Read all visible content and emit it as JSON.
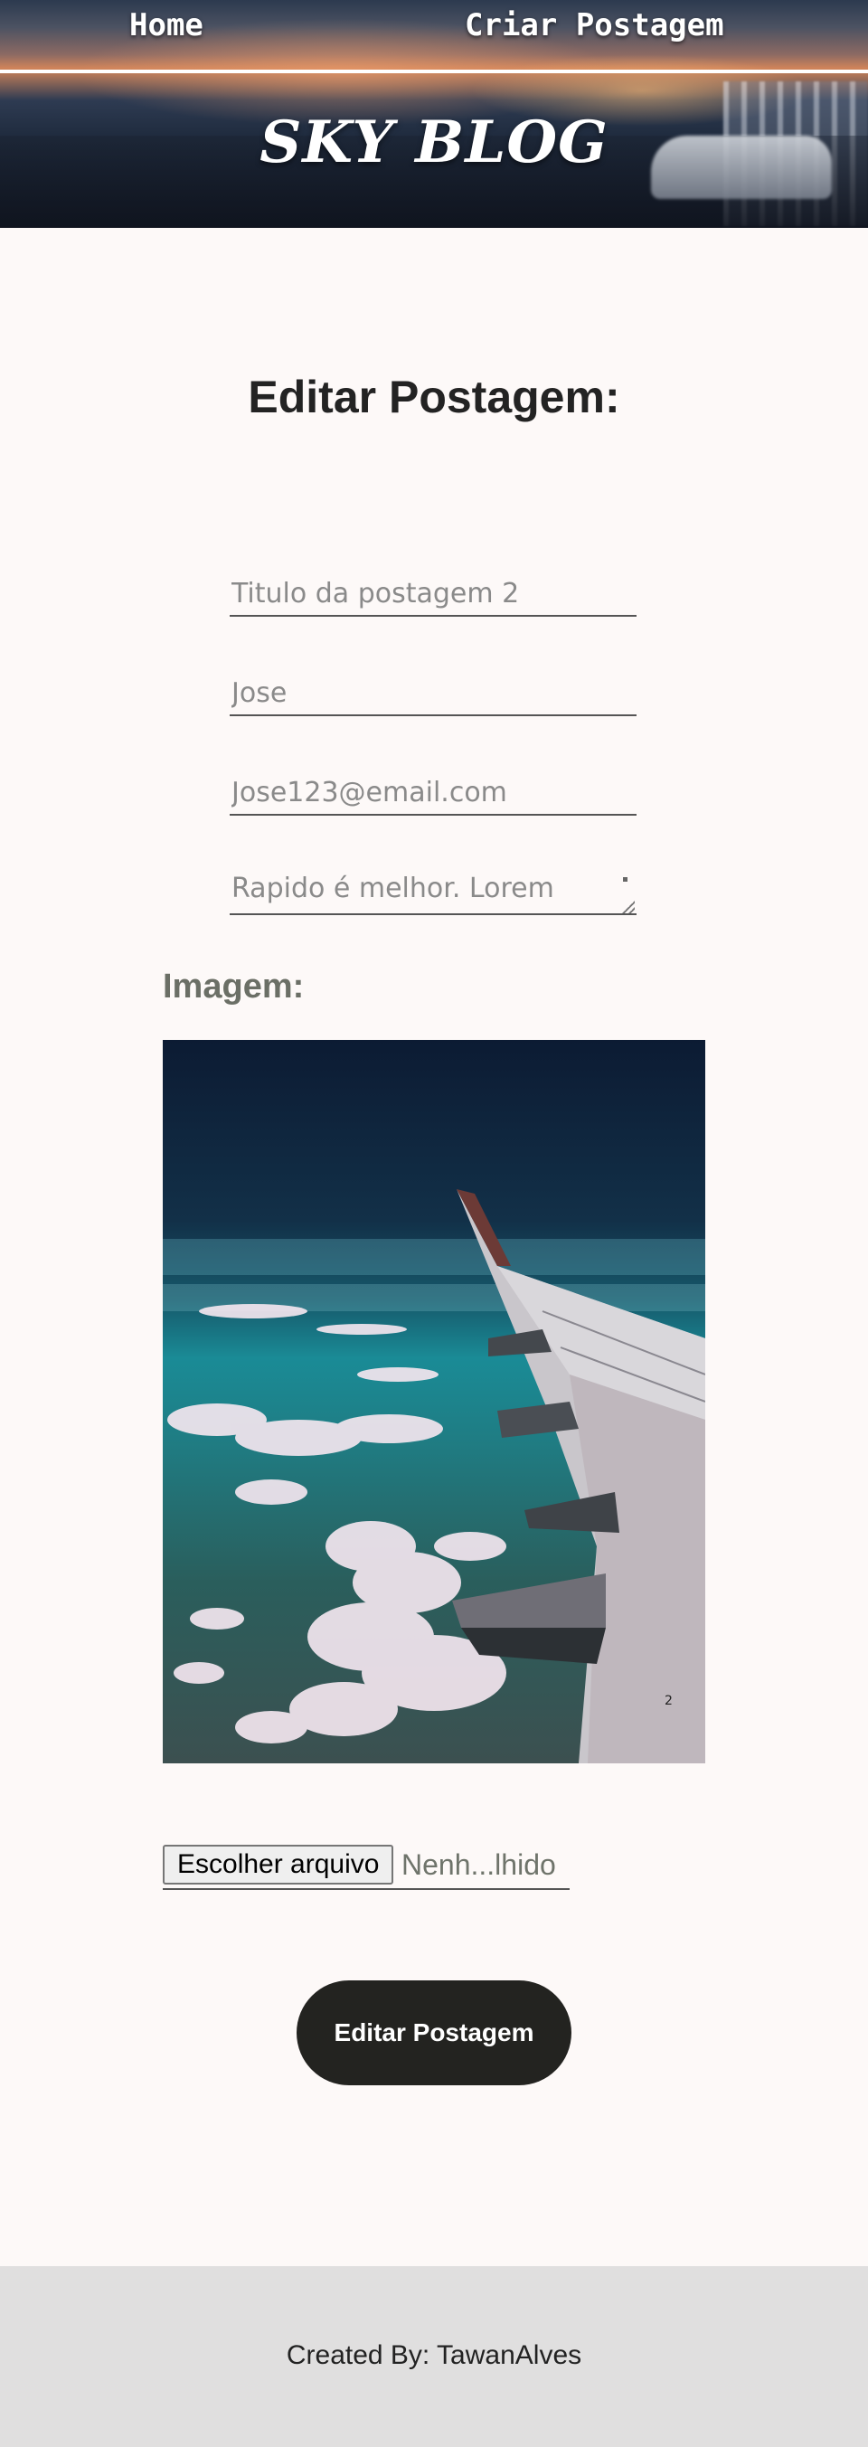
{
  "header": {
    "nav": {
      "home": "Home",
      "create_post": "Criar Postagem"
    },
    "brand": "SKY BLOG"
  },
  "main": {
    "title": "Editar Postagem:",
    "form": {
      "title_value": "Titulo da postagem 2",
      "author_value": "Jose",
      "email_value": "Jose123@email.com",
      "description_value": "Rapido é melhor. Lorem",
      "image_label": "Imagem:",
      "file_button": "Escolher arquivo",
      "file_status": "Nenh...lhido",
      "submit": "Editar Postagem"
    },
    "image": {
      "alt_icon": "airplane-wing-photo"
    }
  },
  "footer": {
    "text": "Created By: TawanAlves"
  }
}
